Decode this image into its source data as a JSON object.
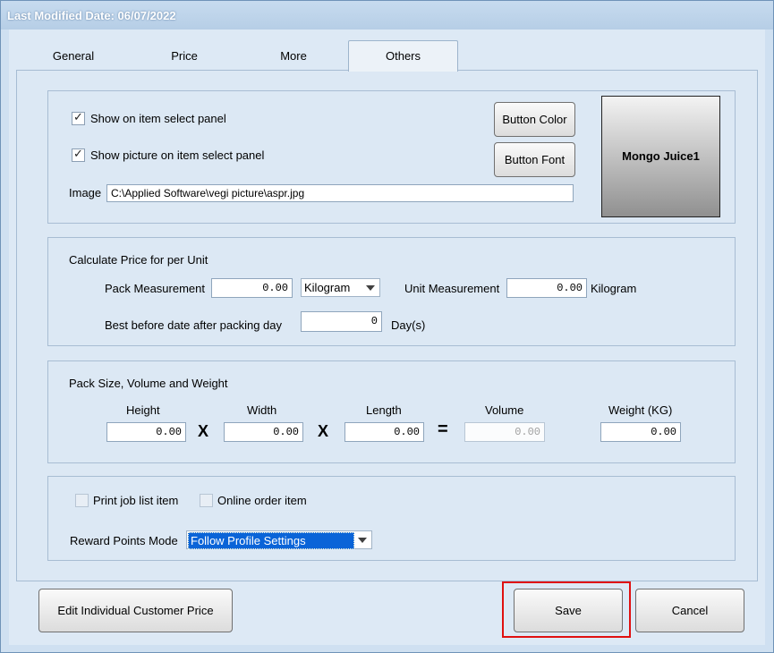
{
  "window": {
    "title": "Last Modified Date: 06/07/2022"
  },
  "tabs": [
    {
      "label": "General"
    },
    {
      "label": "Price"
    },
    {
      "label": "More"
    },
    {
      "label": "Others"
    }
  ],
  "display": {
    "show_on_panel_label": "Show on item select panel",
    "show_on_panel_checked": true,
    "show_picture_label": "Show picture on item select panel",
    "show_picture_checked": true,
    "image_label": "Image",
    "image_path": "C:\\Applied Software\\vegi picture\\aspr.jpg",
    "button_color_label": "Button Color",
    "button_font_label": "Button Font",
    "preview_text": "Mongo Juice1"
  },
  "unit_price": {
    "group_title": "Calculate Price for per Unit",
    "pack_measurement_label": "Pack Measurement",
    "pack_measurement_value": "0.00",
    "pack_unit_selected": "Kilogram",
    "unit_measurement_label": "Unit Measurement",
    "unit_measurement_value": "0.00",
    "unit_measurement_unit": "Kilogram",
    "best_before_label": "Best before date after packing day",
    "best_before_value": "0",
    "best_before_unit": "Day(s)"
  },
  "pack_size": {
    "group_title": "Pack Size,  Volume and Weight",
    "height_label": "Height",
    "height_value": "0.00",
    "width_label": "Width",
    "width_value": "0.00",
    "length_label": "Length",
    "length_value": "0.00",
    "volume_label": "Volume",
    "volume_value": "0.00",
    "weight_label": "Weight (KG)",
    "weight_value": "0.00",
    "times_symbol": "X",
    "equals_symbol": "="
  },
  "misc": {
    "print_job_label": "Print job list item",
    "print_job_checked": false,
    "online_order_label": "Online order item",
    "online_order_checked": false,
    "reward_label": "Reward Points Mode",
    "reward_selected": "Follow Profile Settings"
  },
  "footer": {
    "edit_price_label": "Edit Individual Customer Price",
    "save_label": "Save",
    "cancel_label": "Cancel"
  },
  "colors": {
    "highlight": "#e01010",
    "selection": "#0a64d8"
  }
}
